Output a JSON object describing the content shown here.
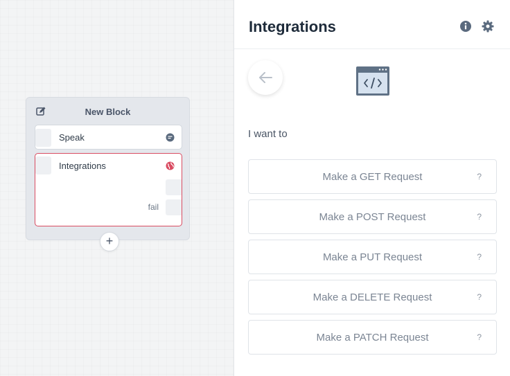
{
  "canvas": {
    "block": {
      "title": "New Block",
      "steps": [
        {
          "label": "Speak",
          "icon": "speak-bubble-icon"
        },
        {
          "label": "Integrations",
          "icon": "globe-icon",
          "ports": [
            "",
            "fail"
          ]
        }
      ],
      "add_step_label": "+"
    }
  },
  "panel": {
    "title": "Integrations",
    "header_icons": [
      "info-icon",
      "gear-icon"
    ],
    "prompt": "I want to",
    "options": [
      {
        "label": "Make a GET Request",
        "help": "?"
      },
      {
        "label": "Make a POST Request",
        "help": "?"
      },
      {
        "label": "Make a PUT Request",
        "help": "?"
      },
      {
        "label": "Make a DELETE Request",
        "help": "?"
      },
      {
        "label": "Make a PATCH Request",
        "help": "?"
      }
    ]
  },
  "colors": {
    "accent_red": "#d94b61",
    "icon_gray": "#5a6a7e",
    "text_dark": "#1e2b3a"
  }
}
